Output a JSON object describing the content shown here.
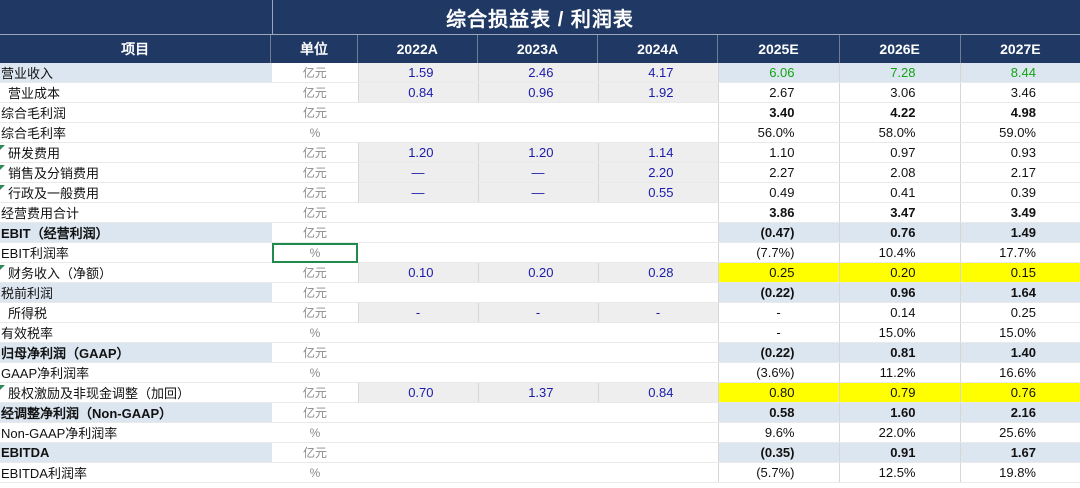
{
  "title": "综合损益表 / 利润表",
  "headers": [
    "项目",
    "单位",
    "2022A",
    "2023A",
    "2024A",
    "2025E",
    "2026E",
    "2027E"
  ],
  "rows": [
    {
      "item": "营业收入",
      "unit": "亿元",
      "v": [
        "1.59",
        "2.46",
        "4.17",
        "6.06",
        "7.28",
        "8.44"
      ],
      "bold": false,
      "indent": false,
      "shade": true,
      "green": true
    },
    {
      "item": "营业成本",
      "unit": "亿元",
      "v": [
        "0.84",
        "0.96",
        "1.92",
        "2.67",
        "3.06",
        "3.46"
      ],
      "indent": true
    },
    {
      "item": "综合毛利润",
      "unit": "亿元",
      "v": [
        "",
        "",
        "",
        "3.40",
        "4.22",
        "4.98"
      ],
      "pbold": true
    },
    {
      "item": "综合毛利率",
      "unit": "%",
      "v": [
        "",
        "",
        "",
        "56.0%",
        "58.0%",
        "59.0%"
      ]
    },
    {
      "item": "研发费用",
      "unit": "亿元",
      "v": [
        "1.20",
        "1.20",
        "1.14",
        "1.10",
        "0.97",
        "0.93"
      ],
      "indent": true,
      "flag": true
    },
    {
      "item": "销售及分销费用",
      "unit": "亿元",
      "v": [
        "—",
        "—",
        "2.20",
        "2.27",
        "2.08",
        "2.17"
      ],
      "indent": true,
      "flag": true
    },
    {
      "item": "行政及一般费用",
      "unit": "亿元",
      "v": [
        "—",
        "—",
        "0.55",
        "0.49",
        "0.41",
        "0.39"
      ],
      "indent": true,
      "flag": true
    },
    {
      "item": "经营费用合计",
      "unit": "亿元",
      "v": [
        "",
        "",
        "",
        "3.86",
        "3.47",
        "3.49"
      ],
      "pbold": true
    },
    {
      "item": "EBIT（经营利润）",
      "unit": "亿元",
      "v": [
        "",
        "",
        "",
        "(0.47)",
        "0.76",
        "1.49"
      ],
      "bold": true,
      "shade": true,
      "pbold": true
    },
    {
      "item": "EBIT利润率",
      "unit": "%",
      "v": [
        "",
        "",
        "",
        "(7.7%)",
        "10.4%",
        "17.7%"
      ],
      "selected": true
    },
    {
      "item": "财务收入（净额）",
      "unit": "亿元",
      "v": [
        "0.10",
        "0.20",
        "0.28",
        "0.25",
        "0.20",
        "0.15"
      ],
      "indent": true,
      "flag": true,
      "yellow": true
    },
    {
      "item": "税前利润",
      "unit": "亿元",
      "v": [
        "",
        "",
        "",
        "(0.22)",
        "0.96",
        "1.64"
      ],
      "shade": true,
      "pbold": true
    },
    {
      "item": "所得税",
      "unit": "亿元",
      "v": [
        "-",
        "-",
        "-",
        "-",
        "0.14",
        "0.25"
      ],
      "indent": true
    },
    {
      "item": "有效税率",
      "unit": "%",
      "v": [
        "",
        "",
        "",
        "-",
        "15.0%",
        "15.0%"
      ]
    },
    {
      "item": "归母净利润（GAAP）",
      "unit": "亿元",
      "v": [
        "",
        "",
        "",
        "(0.22)",
        "0.81",
        "1.40"
      ],
      "bold": true,
      "shade": true,
      "pbold": true
    },
    {
      "item": "GAAP净利润率",
      "unit": "%",
      "v": [
        "",
        "",
        "",
        "(3.6%)",
        "11.2%",
        "16.6%"
      ]
    },
    {
      "item": "股权激励及非现金调整（加回）",
      "unit": "亿元",
      "v": [
        "0.70",
        "1.37",
        "0.84",
        "0.80",
        "0.79",
        "0.76"
      ],
      "indent": true,
      "flag": true,
      "yellow": true
    },
    {
      "item": "经调整净利润（Non-GAAP）",
      "unit": "亿元",
      "v": [
        "",
        "",
        "",
        "0.58",
        "1.60",
        "2.16"
      ],
      "bold": true,
      "shade": true,
      "pbold": true
    },
    {
      "item": "Non-GAAP净利润率",
      "unit": "%",
      "v": [
        "",
        "",
        "",
        "9.6%",
        "22.0%",
        "25.6%"
      ]
    },
    {
      "item": "EBITDA",
      "unit": "亿元",
      "v": [
        "",
        "",
        "",
        "(0.35)",
        "0.91",
        "1.67"
      ],
      "bold": true,
      "shade": true,
      "pbold": true
    },
    {
      "item": "EBITDA利润率",
      "unit": "%",
      "v": [
        "",
        "",
        "",
        "(5.7%)",
        "12.5%",
        "19.8%"
      ]
    }
  ],
  "colors": {
    "header_bg": "#1f3864",
    "shade": "#dce6f1",
    "highlight": "#ffff00",
    "hist_text": "#1a1aa8",
    "green_text": "#14a314",
    "selection": "#1e8a4c"
  }
}
